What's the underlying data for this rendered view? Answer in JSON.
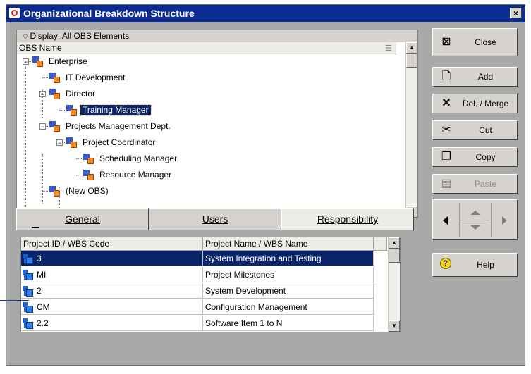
{
  "window": {
    "title": "Organizational Breakdown Structure",
    "close_glyph": "×"
  },
  "tree": {
    "display_label": "Display: All OBS Elements",
    "column_header": "OBS Name",
    "nodes": [
      {
        "label": "Enterprise",
        "level": 0,
        "expander": "−"
      },
      {
        "label": "IT Development",
        "level": 1,
        "expander": ""
      },
      {
        "label": "Director",
        "level": 1,
        "expander": "−"
      },
      {
        "label": "Training Manager",
        "level": 2,
        "expander": "",
        "selected": true
      },
      {
        "label": "Projects Management Dept.",
        "level": 1,
        "expander": "−"
      },
      {
        "label": "Project Coordinator",
        "level": 2,
        "expander": "−"
      },
      {
        "label": "Scheduling Manager",
        "level": 3,
        "expander": ""
      },
      {
        "label": "Resource Manager",
        "level": 3,
        "expander": ""
      },
      {
        "label": "(New OBS)",
        "level": 1,
        "expander": ""
      }
    ]
  },
  "tabs": [
    {
      "label": "General",
      "active": false
    },
    {
      "label": "Users",
      "active": false
    },
    {
      "label": "Responsibility",
      "active": true
    }
  ],
  "grid": {
    "columns": [
      "Project ID / WBS Code",
      "Project Name / WBS Name"
    ],
    "rows": [
      {
        "code": "3",
        "name": "System Integration and Testing",
        "selected": true
      },
      {
        "code": "MI",
        "name": "Project Milestones",
        "selected": false
      },
      {
        "code": "2",
        "name": "System Development",
        "selected": false
      },
      {
        "code": "CM",
        "name": "Configuration Management",
        "selected": false
      },
      {
        "code": "2.2",
        "name": "Software Item 1 to N",
        "selected": false
      }
    ]
  },
  "buttons": {
    "close": "Close",
    "add": "Add",
    "del_merge": "Del. / Merge",
    "cut": "Cut",
    "copy": "Copy",
    "paste": "Paste",
    "help": "Help"
  },
  "colors": {
    "titlebar": "#0c2b92",
    "selection": "#0a246a",
    "panel": "#a9a9a9",
    "button_face": "#d6d3ce"
  }
}
